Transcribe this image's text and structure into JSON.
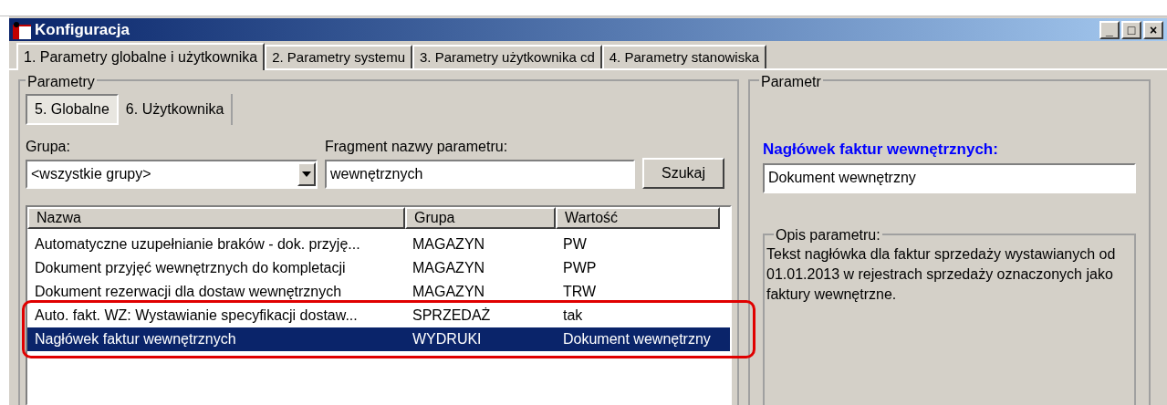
{
  "window": {
    "title": "Konfiguracja"
  },
  "window_controls": [
    "_",
    "□",
    "×"
  ],
  "tabs": [
    {
      "label": "1. Parametry globalne i użytkownika",
      "selected": true
    },
    {
      "label": "2. Parametry systemu",
      "selected": false
    },
    {
      "label": "3. Parametry użytkownika cd",
      "selected": false
    },
    {
      "label": "4. Parametry stanowiska",
      "selected": false
    }
  ],
  "parameters_panel": {
    "title": "Parametry",
    "subtabs": [
      {
        "label": "5. Globalne",
        "selected": true
      },
      {
        "label": "6. Użytkownika",
        "selected": false
      }
    ],
    "group_label": "Grupa:",
    "group_value": "<wszystkie grupy>",
    "fragment_label": "Fragment nazwy parametru:",
    "fragment_value": "wewnętrznych",
    "search_button": "Szukaj",
    "table": {
      "columns": [
        "Nazwa",
        "Grupa",
        "Wartość"
      ],
      "rows": [
        {
          "cells": [
            "Automatyczne uzupełnianie braków - dok. przyję...",
            "MAGAZYN",
            "PW"
          ],
          "selected": false,
          "highlighted": false
        },
        {
          "cells": [
            "Dokument przyjęć wewnętrznych do kompletacji",
            "MAGAZYN",
            "PWP"
          ],
          "selected": false,
          "highlighted": false
        },
        {
          "cells": [
            "Dokument rezerwacji dla dostaw wewnętrznych",
            "MAGAZYN",
            "TRW"
          ],
          "selected": false,
          "highlighted": false
        },
        {
          "cells": [
            "Auto. fakt. WZ: Wystawianie specyfikacji dostaw...",
            "SPRZEDAŻ",
            "tak"
          ],
          "selected": false,
          "highlighted": true
        },
        {
          "cells": [
            "Nagłówek faktur wewnętrznych",
            "WYDRUKI",
            "Dokument wewnętrzny"
          ],
          "selected": true,
          "highlighted": true
        }
      ]
    }
  },
  "parameter_panel": {
    "title": "Parametr",
    "name": "Nagłówek faktur wewnętrznych:",
    "value": "Dokument wewnętrzny",
    "description_title": "Opis parametru:",
    "description": "Tekst nagłówka dla faktur sprzedaży wystawianych od 01.01.2013 w rejestrach sprzedaży oznaczonych jako faktury wewnętrzne."
  }
}
